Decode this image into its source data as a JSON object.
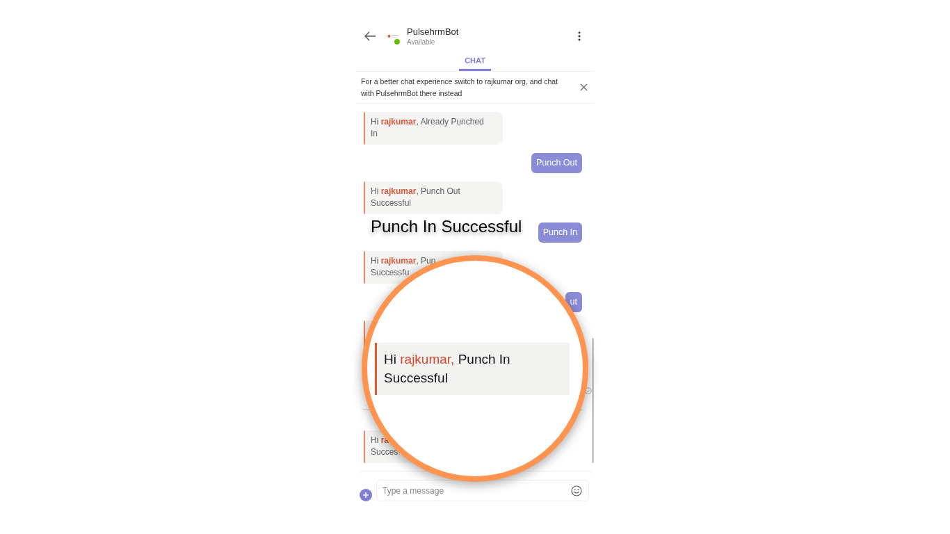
{
  "header": {
    "name": "PulsehrmBot",
    "status": "Available",
    "online": true
  },
  "tabs": [
    {
      "label": "CHAT",
      "selected": true
    }
  ],
  "banner": {
    "text": "For a better chat experience switch to rajkumar org, and chat with PulsehrmBot there instead"
  },
  "messages": [
    {
      "kind": "bot",
      "lines": [
        "Hi **rajkumar**, Already Punched",
        "In"
      ]
    },
    {
      "kind": "user",
      "text": "Punch Out"
    },
    {
      "kind": "bot",
      "lines": [
        "Hi **rajkumar**, Punch Out",
        "Successful"
      ]
    },
    {
      "kind": "user",
      "text": "Punch In"
    },
    {
      "kind": "bot",
      "lines": [
        "Hi **rajkumar**, Pun",
        "Successfu"
      ]
    },
    {
      "kind": "user",
      "text": "ut"
    },
    {
      "kind": "covered"
    },
    {
      "kind": "receipt"
    },
    {
      "kind": "divider"
    },
    {
      "kind": "bot",
      "lines": [
        "Hi **ra**",
        "Succes"
      ]
    }
  ],
  "caption": "Punch In Successful",
  "magnifier": {
    "greeting": "Hi",
    "name": "rajkumar,",
    "text": "Punch In Successful"
  },
  "composer": {
    "placeholder": "Type a message"
  }
}
